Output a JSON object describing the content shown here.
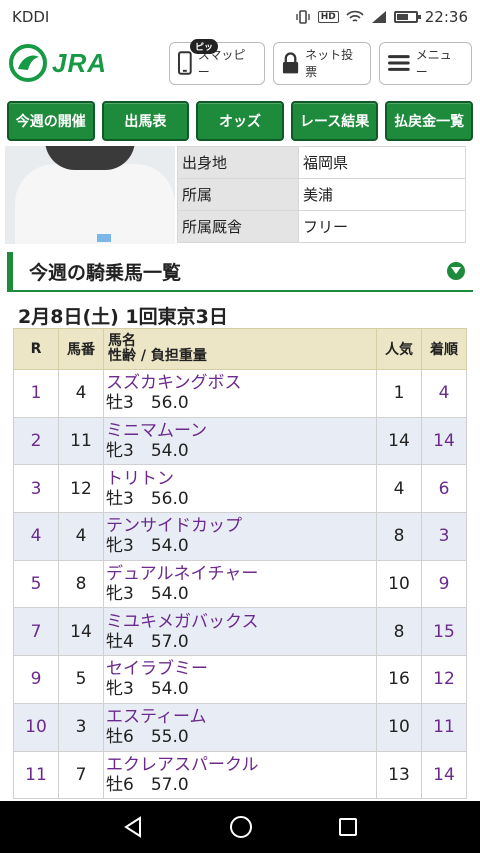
{
  "status": {
    "carrier": "KDDI",
    "time": "22:36",
    "hd": "HD"
  },
  "header": {
    "logo_text": "JRA",
    "smappy": {
      "label": "スマッピー",
      "badge": "ピッ"
    },
    "vote_label": "ネット投票",
    "menu_label": "メニュー"
  },
  "nav": [
    {
      "label": "今週の開催"
    },
    {
      "label": "出馬表"
    },
    {
      "label": "オッズ"
    },
    {
      "label": "レース結果"
    },
    {
      "label": "払戻金一覧"
    }
  ],
  "profile": {
    "rows": [
      {
        "key": "出身地",
        "value": "福岡県"
      },
      {
        "key": "所属",
        "value": "美浦"
      },
      {
        "key": "所属厩舎",
        "value": "フリー"
      }
    ]
  },
  "section": {
    "title": "今週の騎乗馬一覧"
  },
  "date": "2月8日(土) 1回東京3日",
  "table": {
    "headers": {
      "race": "R",
      "number": "馬番",
      "horse_line1": "馬名",
      "horse_line2": "性齢 / 負担重量",
      "popularity": "人気",
      "order": "着順"
    },
    "rows": [
      {
        "race": "1",
        "number": "4",
        "name": "スズカキングボス",
        "info": "牡3　56.0",
        "popularity": "1",
        "order": "4"
      },
      {
        "race": "2",
        "number": "11",
        "name": "ミニマムーン",
        "info": "牝3　54.0",
        "popularity": "14",
        "order": "14"
      },
      {
        "race": "3",
        "number": "12",
        "name": "トリトン",
        "info": "牡3　56.0",
        "popularity": "4",
        "order": "6"
      },
      {
        "race": "4",
        "number": "4",
        "name": "テンサイドカップ",
        "info": "牝3　54.0",
        "popularity": "8",
        "order": "3"
      },
      {
        "race": "5",
        "number": "8",
        "name": "デュアルネイチャー",
        "info": "牝3　54.0",
        "popularity": "10",
        "order": "9"
      },
      {
        "race": "7",
        "number": "14",
        "name": "ミユキメガバックス",
        "info": "牡4　57.0",
        "popularity": "8",
        "order": "15"
      },
      {
        "race": "9",
        "number": "5",
        "name": "セイラブミー",
        "info": "牝3　54.0",
        "popularity": "16",
        "order": "12"
      },
      {
        "race": "10",
        "number": "3",
        "name": "エスティーム",
        "info": "牡6　55.0",
        "popularity": "10",
        "order": "11"
      },
      {
        "race": "11",
        "number": "7",
        "name": "エクレアスパークル",
        "info": "牡6　57.0",
        "popularity": "13",
        "order": "14"
      }
    ]
  },
  "colors": {
    "brand_green": "#1e8a3c",
    "link_purple": "#6b2a8c",
    "header_tan": "#ece6c6",
    "row_alt": "#e8edf5"
  }
}
